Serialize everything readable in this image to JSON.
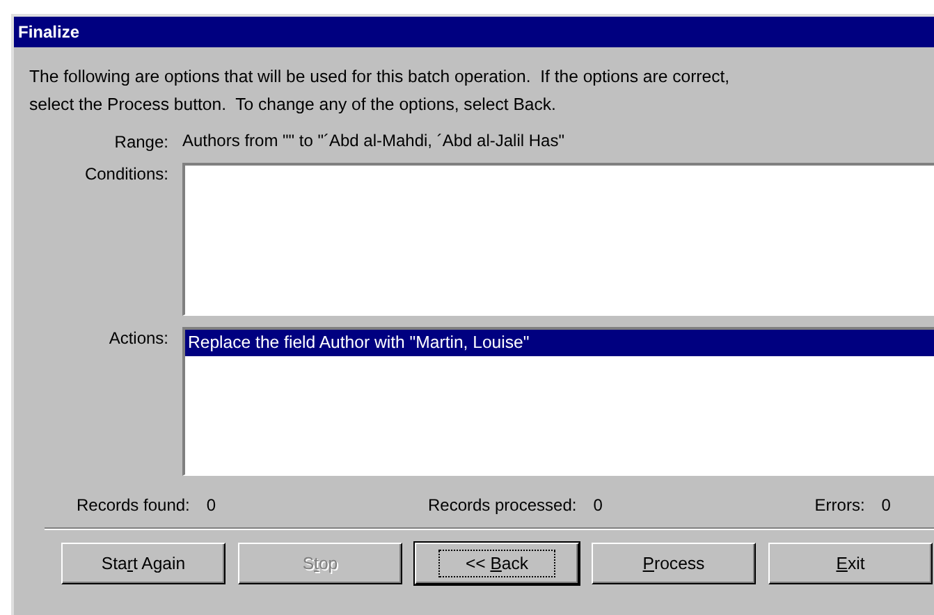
{
  "window": {
    "title": "Finalize"
  },
  "intro": "The following are options that will be used for this batch operation.  If the options are correct, select the Process button.  To change any of the options, select Back.",
  "range": {
    "label": "Range:",
    "value": "Authors from \"\" to \"´Abd al-Mahdi, ´Abd al-Jalil Has\""
  },
  "conditions": {
    "label": "Conditions:"
  },
  "actions": {
    "label": "Actions:",
    "items": [
      {
        "text": "Replace the field Author with \"Martin, Louise\"",
        "selected": true
      }
    ]
  },
  "counts": [
    {
      "label": "Records found:",
      "value": "0"
    },
    {
      "label": "Records processed:",
      "value": "0"
    },
    {
      "label": "Errors:",
      "value": "0"
    }
  ],
  "buttons": [
    {
      "before": "Sta",
      "mnemonic": "r",
      "after": "t Again",
      "disabled": false,
      "default": false
    },
    {
      "before": "S",
      "mnemonic": "t",
      "after": "op",
      "disabled": true,
      "default": false
    },
    {
      "before": "<< ",
      "mnemonic": "B",
      "after": "ack",
      "disabled": false,
      "default": true
    },
    {
      "mnemonic": "P",
      "after": "rocess",
      "disabled": false,
      "default": false
    },
    {
      "mnemonic": "E",
      "after": "xit",
      "disabled": false,
      "default": false
    }
  ]
}
